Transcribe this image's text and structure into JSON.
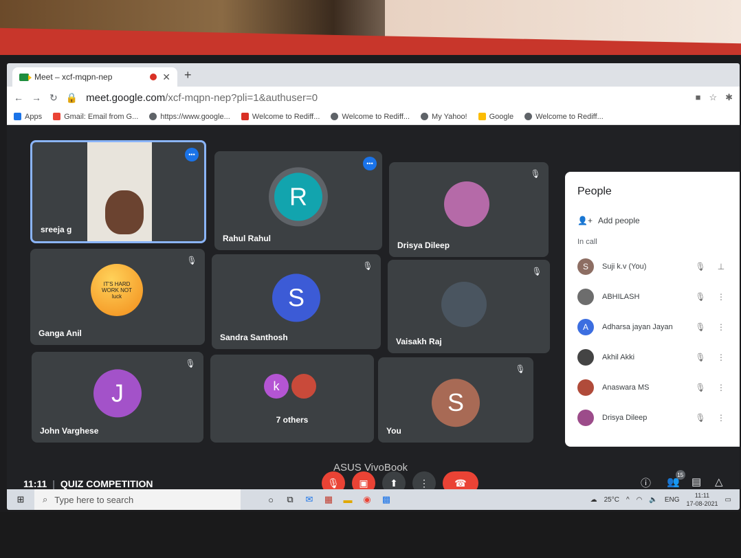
{
  "browser": {
    "tab_title": "Meet – xcf-mqpn-nep",
    "url_host": "meet.google.com",
    "url_path": "/xcf-mqpn-nep?pli=1&authuser=0",
    "bookmarks": [
      "Apps",
      "Gmail: Email from G...",
      "https://www.google...",
      "Welcome to Rediff...",
      "Welcome to Rediff...",
      "My Yahoo!",
      "Google",
      "Welcome to Rediff..."
    ]
  },
  "tiles": [
    {
      "name": "sreeja g",
      "avatar": "",
      "color": "#5f6368",
      "speaking": true
    },
    {
      "name": "Rahul Rahul",
      "avatar": "R",
      "color": "#12a4ae",
      "speaking": true
    },
    {
      "name": "Drisya Dileep",
      "avatar": "",
      "color": "#a14c8e",
      "muted": true
    },
    {
      "name": "Ganga Anil",
      "avatar": "",
      "color": "#f39c12",
      "muted": true
    },
    {
      "name": "Sandra Santhosh",
      "avatar": "S",
      "color": "#3c5bd6",
      "muted": true
    },
    {
      "name": "Vaisakh Raj",
      "avatar": "",
      "color": "#4a5560",
      "muted": true
    },
    {
      "name": "John Varghese",
      "avatar": "J",
      "color": "#a352c9",
      "muted": true
    },
    {
      "name": "7 others",
      "avatar": "k",
      "color": "#b455d3"
    },
    {
      "name": "You",
      "avatar": "S",
      "color": "#a86a55",
      "muted": true
    }
  ],
  "sticker_text": "IT'S HARD WORK NOT luck",
  "people": {
    "title": "People",
    "add_label": "Add people",
    "section": "In call",
    "list": [
      {
        "name": "Suji k.v (You)",
        "initial": "S",
        "color": "#8d6e63"
      },
      {
        "name": "ABHILASH",
        "initial": "",
        "color": "#6d6d6d"
      },
      {
        "name": "Adharsa jayan Jayan",
        "initial": "A",
        "color": "#3c6ee0"
      },
      {
        "name": "Akhil Akki",
        "initial": "",
        "color": "#444"
      },
      {
        "name": "Anaswara MS",
        "initial": "",
        "color": "#b04b3a"
      },
      {
        "name": "Drisya Dileep",
        "initial": "",
        "color": "#9c4c8a"
      }
    ]
  },
  "meeting": {
    "time": "11:11",
    "title": "QUIZ COMPETITION",
    "participant_count": "15"
  },
  "taskbar": {
    "search_placeholder": "Type here to search",
    "weather": "25°C",
    "lang": "ENG",
    "time": "11:11",
    "date": "17-08-2021"
  },
  "laptop_brand": "ASUS VivoBook"
}
